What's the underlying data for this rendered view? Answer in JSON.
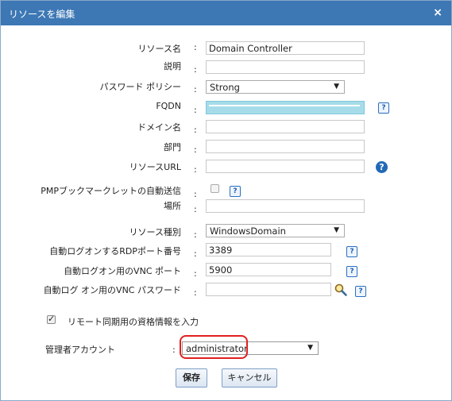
{
  "dialog": {
    "title": "リソースを編集",
    "close": "×"
  },
  "fields": {
    "resource_name": {
      "label": "リソース名",
      "colon": ":",
      "value": "Domain Controller"
    },
    "description": {
      "label": "説明",
      "colon": ":",
      "value": ""
    },
    "password_policy": {
      "label": "パスワード ポリシー",
      "colon": ":",
      "value": "Strong"
    },
    "fqdn": {
      "label": "FQDN",
      "colon": ":",
      "value": ""
    },
    "domain_name": {
      "label": "ドメイン名",
      "colon": ":",
      "value": ""
    },
    "department": {
      "label": "部門",
      "colon": ":",
      "value": ""
    },
    "resource_url": {
      "label": "リソースURL",
      "colon": ":",
      "value": ""
    },
    "auto_send": {
      "label": "PMPブックマークレットの自動送信",
      "colon": ":"
    },
    "location": {
      "label": "場所",
      "colon": ":",
      "value": ""
    },
    "resource_type": {
      "label": "リソース種別",
      "colon": ":",
      "value": "WindowsDomain"
    },
    "rdp_port": {
      "label": "自動ログオンするRDPポート番号",
      "colon": ":",
      "value": "3389"
    },
    "vnc_port": {
      "label": "自動ログオン用のVNC ポート",
      "colon": ":",
      "value": "5900"
    },
    "vnc_password": {
      "label": "自動ログ オン用のVNC パスワード",
      "colon": ":",
      "value": ""
    },
    "remote_sync": {
      "label": "リモート同期用の資格情報を入力"
    },
    "admin_account": {
      "label": "管理者アカウント",
      "colon": ":",
      "value": "administrator"
    }
  },
  "icons": {
    "help": "?",
    "dropdown": "▼",
    "search": "magnifier-icon"
  },
  "buttons": {
    "save": "保存",
    "cancel": "キャンセル"
  },
  "colors": {
    "titlebar": "#3d78b5",
    "highlight": "#e02020",
    "help_icon": "#1d5fb4"
  }
}
